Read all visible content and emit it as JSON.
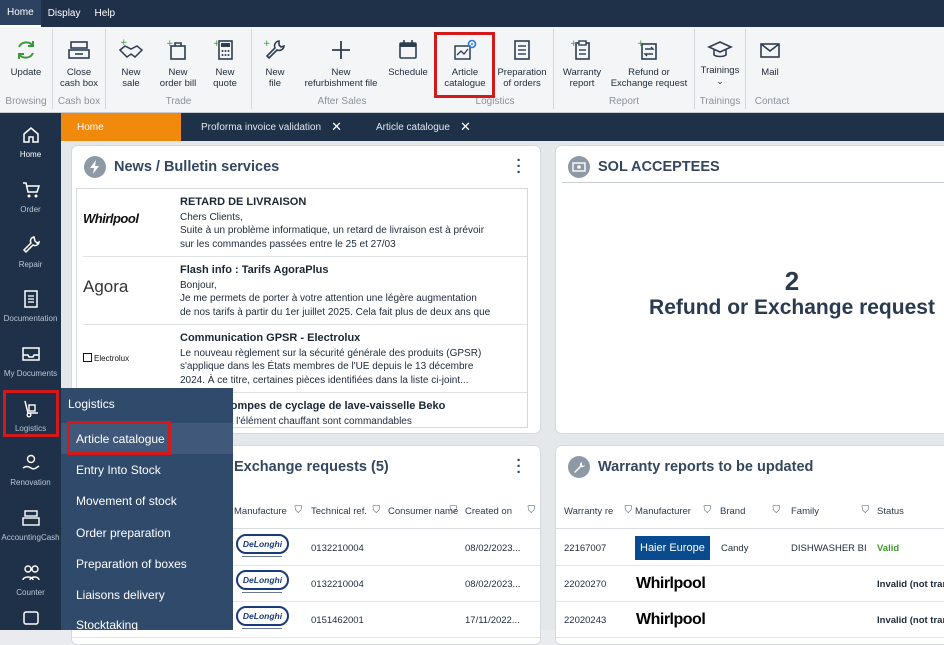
{
  "menubar": {
    "items": [
      "Home",
      "Display",
      "Help"
    ]
  },
  "ribbon": {
    "buttons": {
      "update": "Update",
      "close_cash_box_1": "Close",
      "close_cash_box_2": "cash box",
      "new_sale_1": "New",
      "new_sale_2": "sale",
      "new_order_bill_1": "New",
      "new_order_bill_2": "order bill",
      "new_quote_1": "New",
      "new_quote_2": "quote",
      "new_file_1": "New",
      "new_file_2": "file",
      "new_refurb_1": "New",
      "new_refurb_2": "refurbishment file",
      "schedule": "Schedule",
      "article_catalogue_1": "Article",
      "article_catalogue_2": "catalogue",
      "preparation_orders_1": "Preparation",
      "preparation_orders_2": "of orders",
      "warranty_report_1": "Warranty",
      "warranty_report_2": "report",
      "refund_exchange_1": "Refund or",
      "refund_exchange_2": "Exchange request",
      "trainings": "Trainings",
      "mail": "Mail"
    },
    "groups": {
      "browsing": "Browsing",
      "cash_box": "Cash box",
      "trade": "Trade",
      "after_sales": "After Sales",
      "logistics": "Logistics",
      "report": "Report",
      "trainings": "Trainings",
      "contact": "Contact"
    }
  },
  "sidebar": {
    "items": [
      "Home",
      "Order",
      "Repair",
      "Documentation",
      "My Documents",
      "Logistics",
      "Renovation",
      "AccountingCash",
      "Counter"
    ]
  },
  "tabs": {
    "home": "Home",
    "proforma": "Proforma invoice validation",
    "article_catalogue": "Article catalogue",
    "close": "✕"
  },
  "news": {
    "title": "News / Bulletin services",
    "items": [
      {
        "logo": "Whirlpool",
        "title": "RETARD DE LIVRAISON",
        "lines": [
          "Chers Clients,",
          "Suite à un problème informatique, un retard de livraison est à prévoir",
          "sur les commandes passées entre le 25 et 27/03"
        ]
      },
      {
        "logo": "Agora",
        "title": "Flash info : Tarifs AgoraPlus",
        "lines": [
          "Bonjour,",
          "Je me permets de porter à votre attention une légère augmentation",
          "de nos tarifs à partir du 1er juillet 2025. Cela fait plus de deux ans que"
        ]
      },
      {
        "logo": "Electrolux",
        "title": "Communication GPSR - Electrolux",
        "lines": [
          "Le nouveau règlement sur la sécurité générale des produits (GPSR)",
          "s'applique dans les États membres de l'UE depuis le 13 décembre",
          "2024. À ce titre, certaines pièces identifiées dans la liste ci-joint..."
        ]
      },
      {
        "logo": "",
        "title": "pièces : pompes de cyclage de lave-vaisselle Beko",
        "lines": [
          "e cyclage et l'élément chauffant sont commandables"
        ]
      }
    ]
  },
  "sol": {
    "title": "SOL ACCEPTEES",
    "count": "2",
    "label": "Refund or Exchange request"
  },
  "exchange": {
    "title": "Exchange requests (5)",
    "columns": [
      "Manufacture",
      "Technical ref.",
      "Consumer name",
      "Created on"
    ],
    "rows": [
      {
        "brand": "DeLonghi",
        "ref": "0132210004",
        "consumer": "",
        "created": "08/02/2023..."
      },
      {
        "brand": "DeLonghi",
        "ref": "0132210004",
        "consumer": "",
        "created": "08/02/2023..."
      },
      {
        "brand": "DeLonghi",
        "ref": "0151462001",
        "consumer": "",
        "created": "17/11/2022..."
      }
    ]
  },
  "warranty": {
    "title": "Warranty reports to be updated",
    "columns": [
      "Warranty re",
      "Manufacturer",
      "Brand",
      "Family",
      "Status"
    ],
    "rows": [
      {
        "report": "22167007",
        "manufacturer": "Haier Europe",
        "brand": "Candy",
        "family": "DISHWASHER BI",
        "status": "Valid"
      },
      {
        "report": "22020270",
        "manufacturer": "Whirlpool",
        "brand": "",
        "family": "",
        "status": "Invalid (not tran"
      },
      {
        "report": "22020243",
        "manufacturer": "Whirlpool",
        "brand": "",
        "family": "",
        "status": "Invalid (not tran"
      }
    ]
  },
  "logistics_menu": {
    "title": "Logistics",
    "items": [
      "Article catalogue",
      "Entry Into Stock",
      "Movement of stock",
      "Order preparation",
      "Preparation of boxes",
      "Liaisons delivery",
      "Stocktaking"
    ]
  },
  "colors": {
    "navy": "#1f3148",
    "accent_orange": "#f0890c",
    "highlight_red": "#d31a1a",
    "valid_green": "#3d9a2c"
  }
}
